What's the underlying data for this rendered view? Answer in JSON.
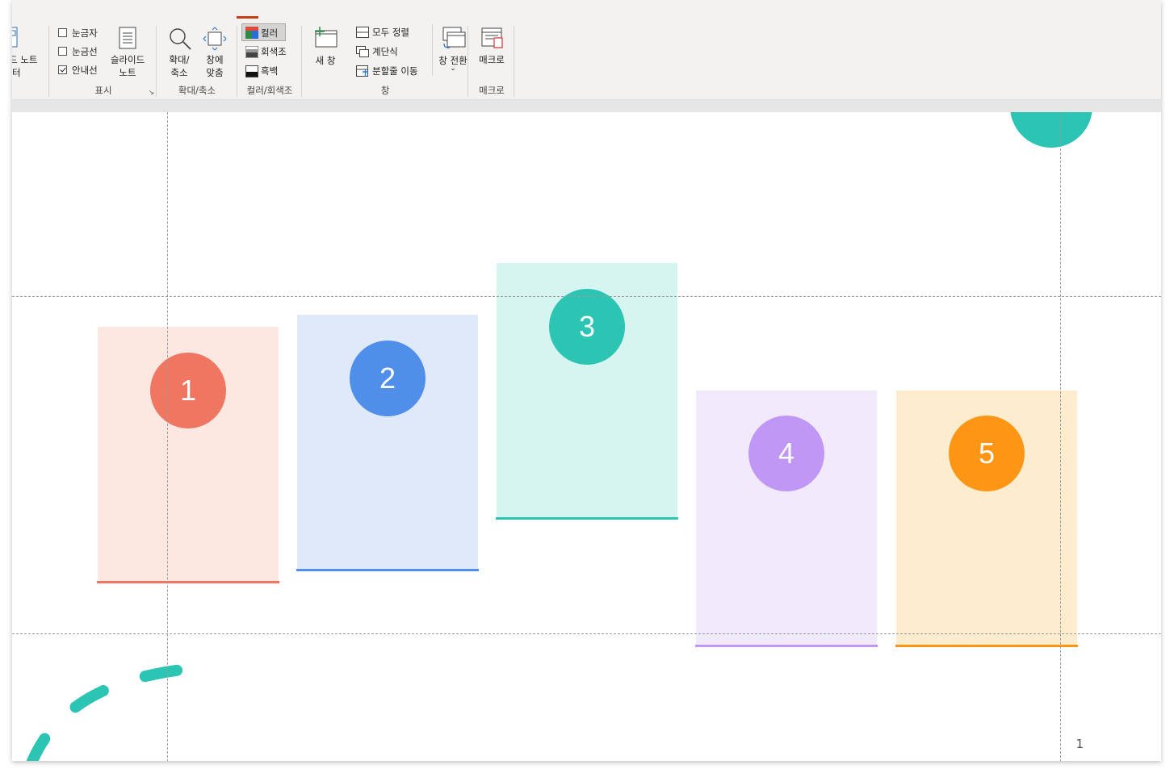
{
  "ribbon": {
    "left_partial": {
      "line1": "드 노트",
      "line2": "터"
    },
    "show_group": {
      "label": "표시",
      "ruler": {
        "label": "눈금자",
        "checked": false
      },
      "gridlines": {
        "label": "눈금선",
        "checked": false
      },
      "guides": {
        "label": "안내선",
        "checked": true
      },
      "notes_button": {
        "line1": "슬라이드",
        "line2": "노트"
      }
    },
    "zoom_group": {
      "label": "확대/축소",
      "zoom_button": {
        "line1": "확대/",
        "line2": "축소"
      },
      "fit_button": {
        "line1": "창에",
        "line2": "맞춤"
      }
    },
    "color_group": {
      "label": "컬러/회색조",
      "color": "컬러",
      "grayscale": "회색조",
      "bw": "흑백"
    },
    "window_group": {
      "label": "창",
      "new_window": "새 창",
      "arrange_all": "모두 정렬",
      "cascade": "계단식",
      "move_split": "분할줄 이동",
      "switch_windows": "창 전환"
    },
    "macro_group": {
      "label": "매크로",
      "macros": "매크로"
    }
  },
  "slide": {
    "page_number": "1",
    "cards": [
      {
        "number": "1",
        "color": "#ef7661",
        "tint": "#fce7e1"
      },
      {
        "number": "2",
        "color": "#4f8fea",
        "tint": "#dfe9fa"
      },
      {
        "number": "3",
        "color": "#2cc4b3",
        "tint": "#d6f4f0"
      },
      {
        "number": "4",
        "color": "#c197f5",
        "tint": "#f1eafc"
      },
      {
        "number": "5",
        "color": "#fc9614",
        "tint": "#feeccf"
      }
    ],
    "accent_teal": "#2cc4b3"
  }
}
